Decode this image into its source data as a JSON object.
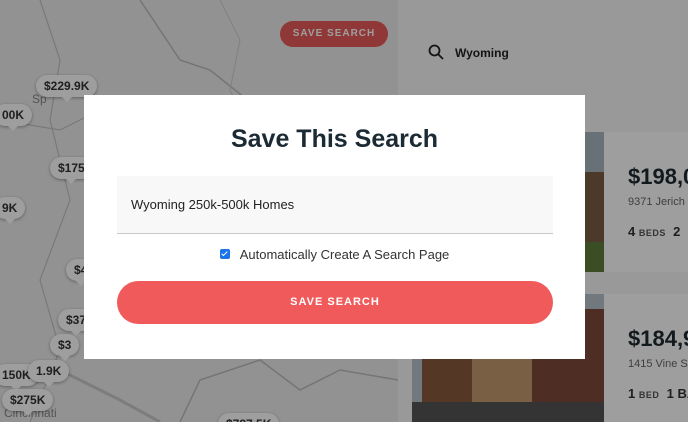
{
  "map": {
    "save_search_label": "SAVE SEARCH",
    "pins": [
      "$229.9K",
      "00K",
      "$175",
      "9K",
      "$4",
      "$37",
      "$3",
      "150K",
      "1.9K",
      "$275K",
      "$787.5K"
    ],
    "city_label": "Cincinnati",
    "small_label": "Sp"
  },
  "search": {
    "query": "Wyoming",
    "icon": "search-icon"
  },
  "listings": [
    {
      "price": "$198,0",
      "address": "9371 Jerich",
      "beds_num": "4",
      "beds_unit": "BEDS",
      "baths_num": "2"
    },
    {
      "price": "$184,9",
      "address": "1415 Vine S",
      "beds_num": "1",
      "beds_unit": "BED",
      "baths_num": "1 BA"
    }
  ],
  "modal": {
    "title": "Save This Search",
    "name_value": "Wyoming 250k-500k Homes",
    "checkbox_label": "Automatically Create A Search Page",
    "checkbox_checked": true,
    "save_label": "SAVE SEARCH"
  },
  "colors": {
    "accent": "#f15a5a",
    "checkbox": "#1a73e8",
    "title": "#1b2a33"
  }
}
